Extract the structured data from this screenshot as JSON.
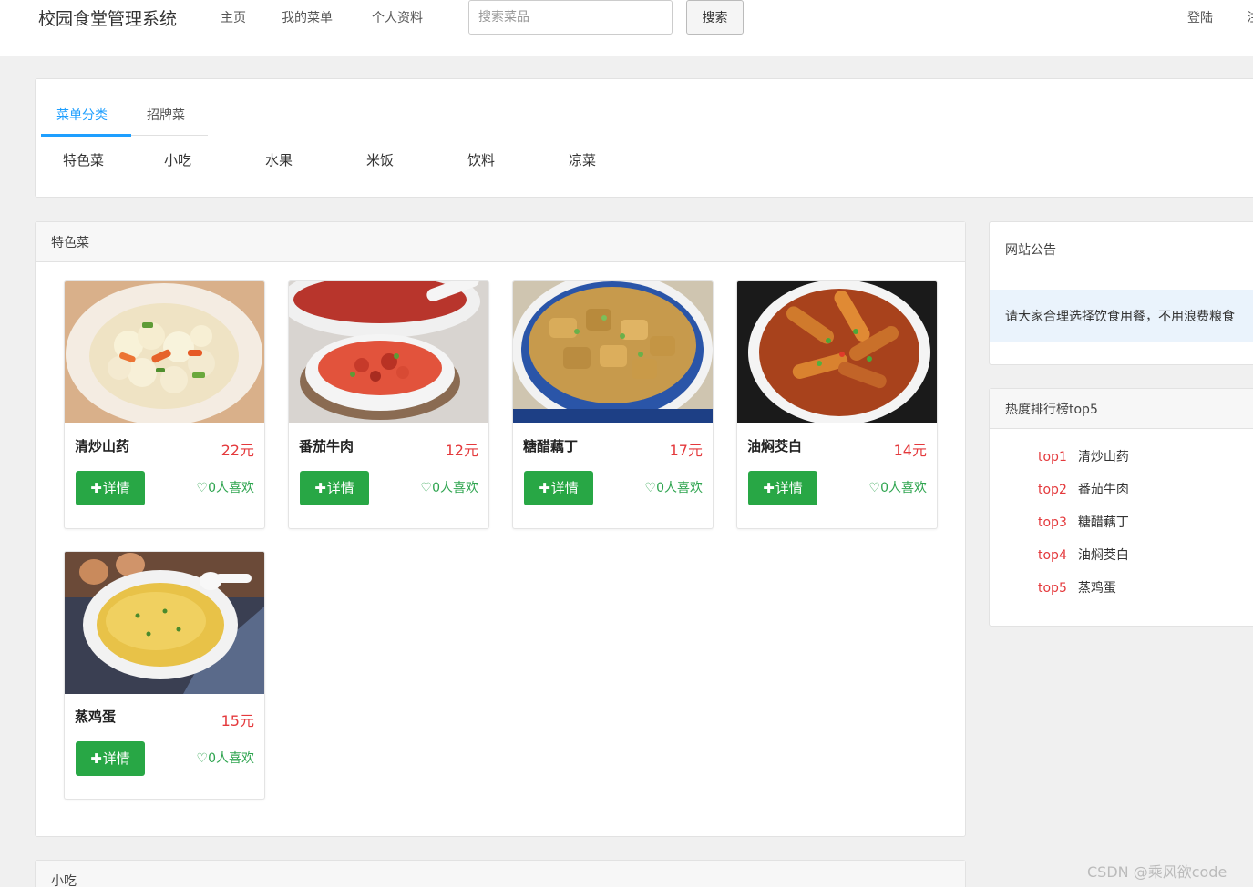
{
  "navbar": {
    "brand": "校园食堂管理系统",
    "links": [
      "主页",
      "我的菜单",
      "个人资料"
    ],
    "search_placeholder": "搜索菜品",
    "search_button": "搜索",
    "login": "登陆",
    "register_partial": "注"
  },
  "category_panel": {
    "tabs": [
      "菜单分类",
      "招牌菜"
    ],
    "categories": [
      "特色菜",
      "小吃",
      "水果",
      "米饭",
      "饮料",
      "凉菜"
    ]
  },
  "featured_panel": {
    "title": "特色菜",
    "dishes": [
      {
        "name": "清炒山药",
        "price": "22元",
        "button": "详情",
        "likes": "0人喜欢",
        "image_icon": "stir-fried-yam-photo"
      },
      {
        "name": "番茄牛肉",
        "price": "12元",
        "button": "详情",
        "likes": "0人喜欢",
        "image_icon": "tomato-beef-photo"
      },
      {
        "name": "糖醋藕丁",
        "price": "17元",
        "button": "详情",
        "likes": "0人喜欢",
        "image_icon": "sweet-sour-lotus-photo"
      },
      {
        "name": "油焖茭白",
        "price": "14元",
        "button": "详情",
        "likes": "0人喜欢",
        "image_icon": "braised-water-bamboo-photo"
      },
      {
        "name": "蒸鸡蛋",
        "price": "15元",
        "button": "详情",
        "likes": "0人喜欢",
        "image_icon": "steamed-egg-photo"
      }
    ]
  },
  "snacks_panel": {
    "title": "小吃"
  },
  "sidebar": {
    "notice_title": "网站公告",
    "notice_text": "请大家合理选择饮食用餐，不用浪费粮食",
    "ranking_title": "热度排行榜top5",
    "ranking": [
      {
        "rank": "top1",
        "name": "清炒山药"
      },
      {
        "rank": "top2",
        "name": "番茄牛肉"
      },
      {
        "rank": "top3",
        "name": "糖醋藕丁"
      },
      {
        "rank": "top4",
        "name": "油焖茭白"
      },
      {
        "rank": "top5",
        "name": "蒸鸡蛋"
      }
    ]
  },
  "watermark": "CSDN @乘风欲code",
  "colors": {
    "accent_blue": "#1e9fff",
    "button_green": "#28a745",
    "price_red": "#e4393c"
  }
}
